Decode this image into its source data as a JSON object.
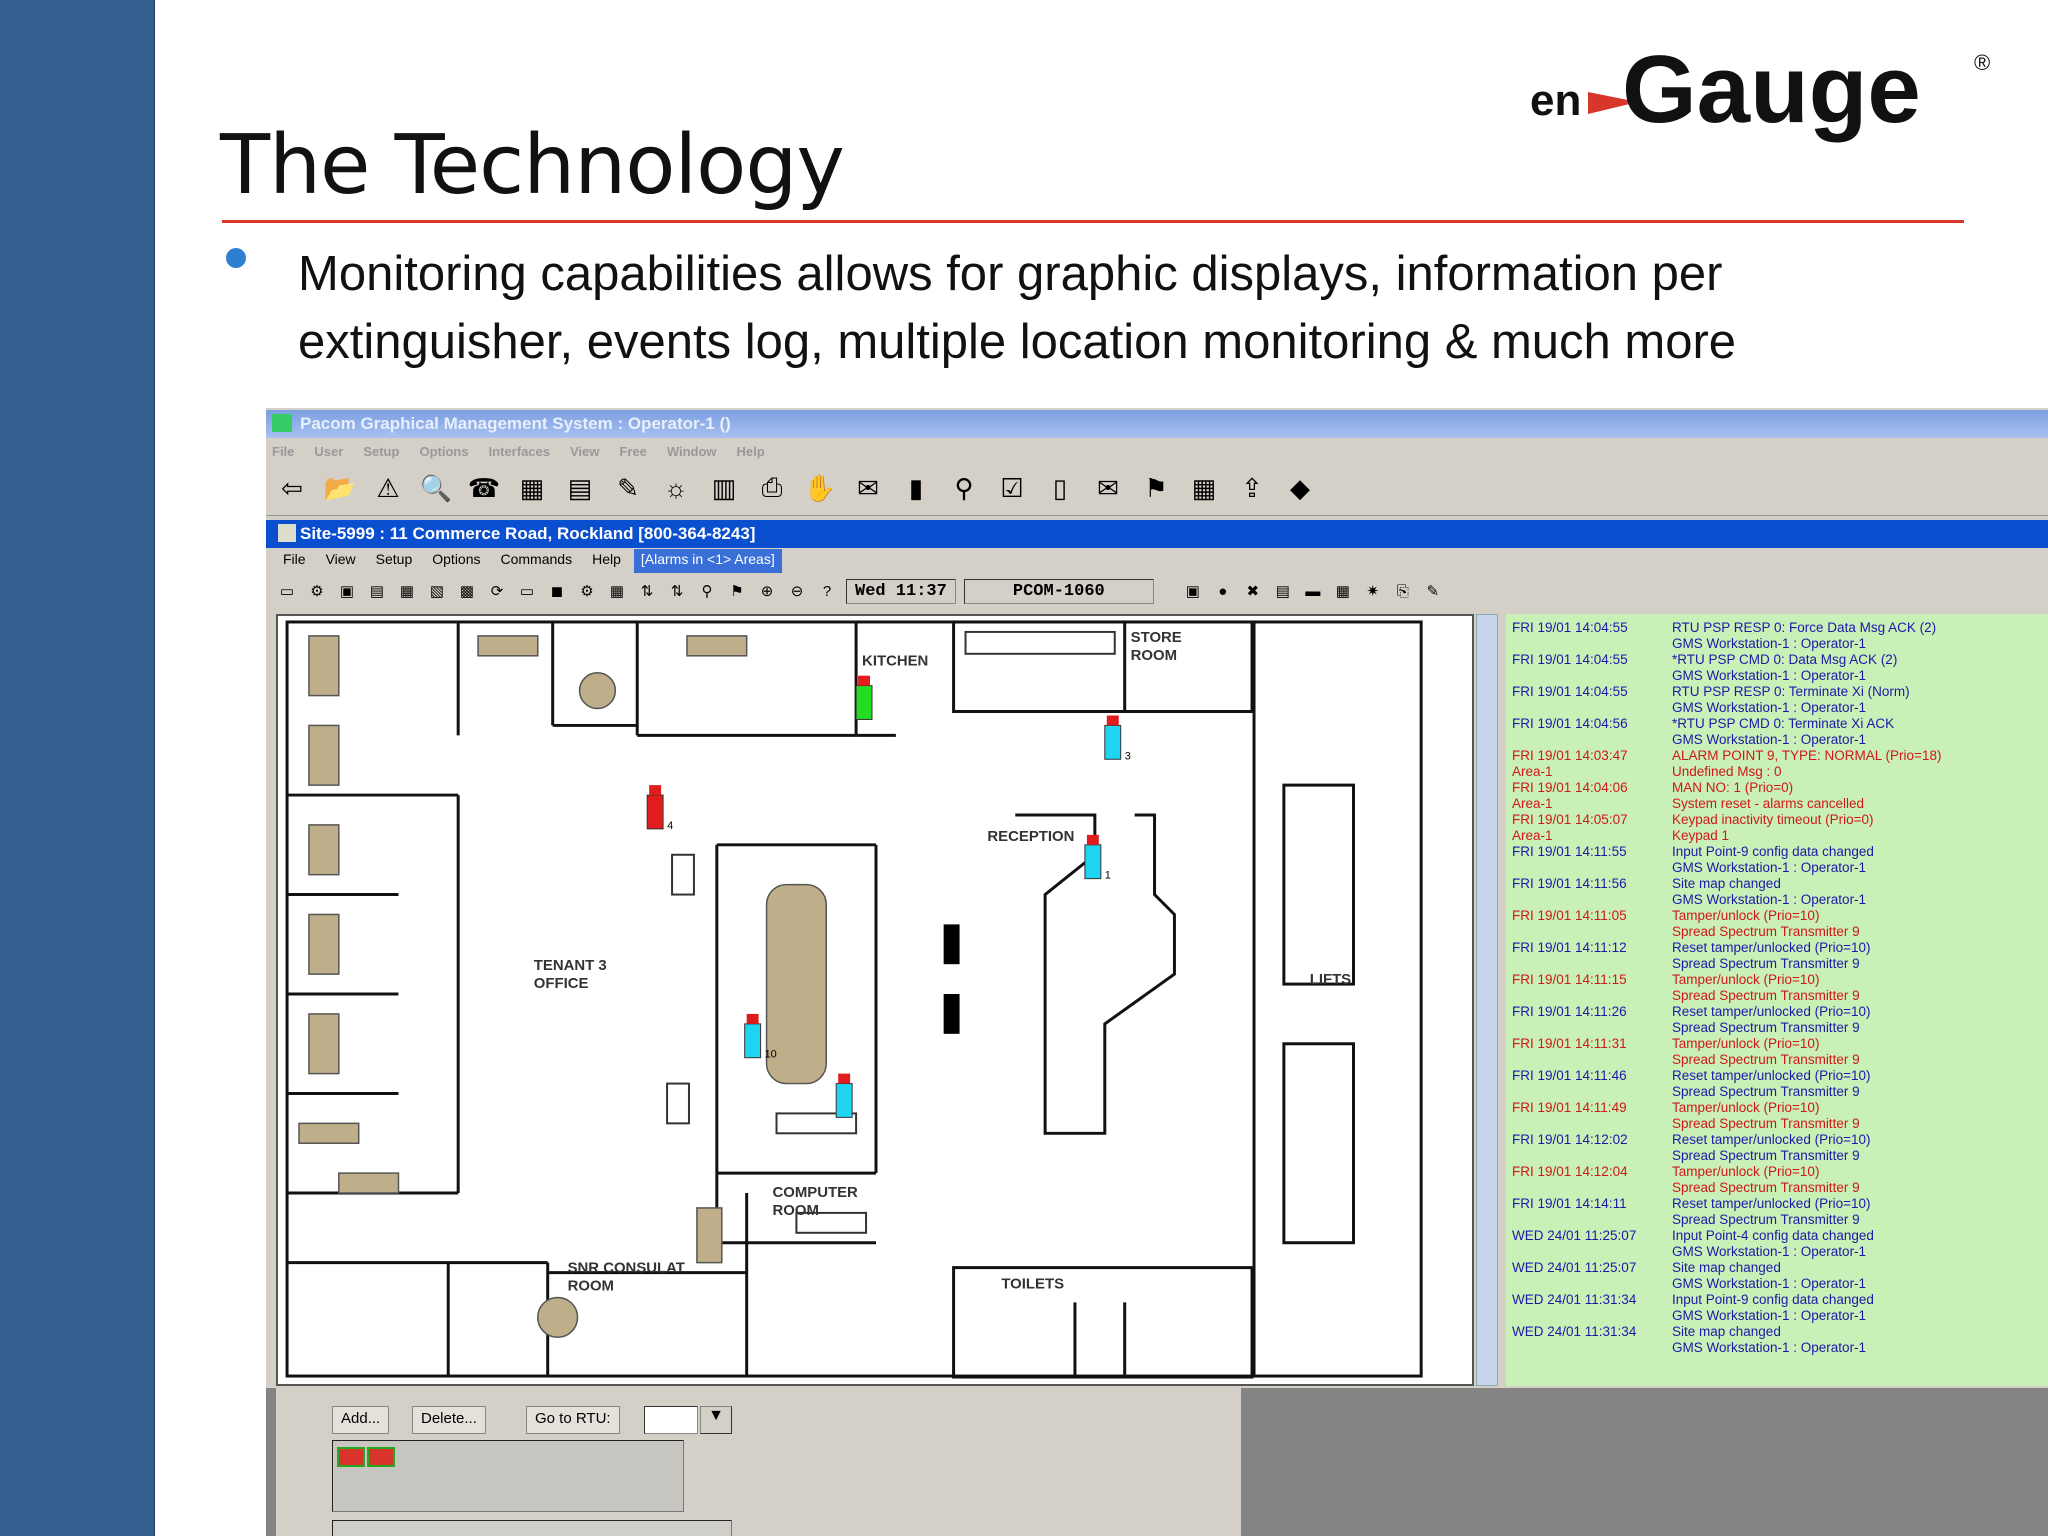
{
  "slide": {
    "title": "The Technology",
    "bullet": "Monitoring capabilities allows for graphic displays, information per extinguisher, events log, multiple location monitoring & much more",
    "logo_text_en": "en",
    "logo_text_main": "Gauge",
    "logo_reg": "®",
    "accent_color": "#d9362b",
    "sidebar_color": "#345f8f"
  },
  "app": {
    "outer_title": "Pacom Graphical Management System : Operator-1 ()",
    "outer_menu": [
      "File",
      "User",
      "Setup",
      "Options",
      "Interfaces",
      "View",
      "Free",
      "Window",
      "Help"
    ],
    "inner_title": "Site-5999 : 11 Commerce Road, Rockland [800-364-8243]",
    "inner_menu": [
      "File",
      "View",
      "Setup",
      "Options",
      "Commands",
      "Help"
    ],
    "alarms_label": "[Alarms in <1> Areas]",
    "clock": "Wed  11:37",
    "device": "PCOM-1060"
  },
  "map": {
    "rooms": {
      "kitchen": "KITCHEN",
      "store": "STORE",
      "store2": "ROOM",
      "reception": "RECEPTION",
      "tenant": "TENANT 3",
      "office": "OFFICE",
      "lifts": "LIFTS",
      "computer": "COMPUTER",
      "computer2": "ROOM",
      "snr": "SNR CONSULAT",
      "snr2": "ROOM",
      "toilets": "TOILETS"
    },
    "extinguishers": [
      {
        "label": "3",
        "color": "#1fd4f0"
      },
      {
        "label": "4",
        "color": "#e01c1c"
      },
      {
        "label": "1",
        "color": "#1fd4f0"
      },
      {
        "label": "10",
        "color": "#1fd4f0"
      },
      {
        "label": "",
        "color": "#22dd22"
      },
      {
        "label": "",
        "color": "#1fd4f0"
      }
    ]
  },
  "log": [
    {
      "time": "FRI 19/01 14:04:55",
      "msg": "RTU PSP RESP 0: Force Data Msg ACK (2)",
      "red": false
    },
    {
      "time": "",
      "msg": "GMS Workstation-1 : Operator-1",
      "red": false
    },
    {
      "time": "FRI 19/01 14:04:55",
      "msg": "*RTU PSP CMD 0: Data Msg ACK (2)",
      "red": false
    },
    {
      "time": "",
      "msg": "GMS Workstation-1 : Operator-1",
      "red": false
    },
    {
      "time": "FRI 19/01 14:04:55",
      "msg": "RTU PSP RESP 0: Terminate Xi (Norm)",
      "red": false
    },
    {
      "time": "",
      "msg": "GMS Workstation-1 : Operator-1",
      "red": false
    },
    {
      "time": "FRI 19/01 14:04:56",
      "msg": "*RTU PSP CMD 0: Terminate Xi ACK",
      "red": false
    },
    {
      "time": "",
      "msg": "GMS Workstation-1 : Operator-1",
      "red": false
    },
    {
      "time": "FRI 19/01 14:03:47",
      "msg": "ALARM POINT 9, TYPE: NORMAL (Prio=18)",
      "red": true
    },
    {
      "time": "Area-1",
      "msg": "Undefined Msg : 0",
      "red": true
    },
    {
      "time": "FRI 19/01 14:04:06",
      "msg": "MAN NO: 1 (Prio=0)",
      "red": true
    },
    {
      "time": "Area-1",
      "msg": "System reset - alarms cancelled",
      "red": true
    },
    {
      "time": "FRI 19/01 14:05:07",
      "msg": "Keypad inactivity timeout (Prio=0)",
      "red": true
    },
    {
      "time": "Area-1",
      "msg": "Keypad 1",
      "red": true
    },
    {
      "time": "FRI 19/01 14:11:55",
      "msg": "Input Point-9 config data changed",
      "red": false
    },
    {
      "time": "",
      "msg": "GMS Workstation-1 : Operator-1",
      "red": false
    },
    {
      "time": "FRI 19/01 14:11:56",
      "msg": "Site map changed",
      "red": false
    },
    {
      "time": "",
      "msg": "GMS Workstation-1 : Operator-1",
      "red": false
    },
    {
      "time": "FRI 19/01 14:11:05",
      "msg": "Tamper/unlock (Prio=10)",
      "red": true
    },
    {
      "time": "",
      "msg": "Spread Spectrum Transmitter 9",
      "red": true
    },
    {
      "time": "FRI 19/01 14:11:12",
      "msg": "Reset tamper/unlocked (Prio=10)",
      "red": false
    },
    {
      "time": "",
      "msg": "Spread Spectrum Transmitter 9",
      "red": false
    },
    {
      "time": "FRI 19/01 14:11:15",
      "msg": "Tamper/unlock (Prio=10)",
      "red": true
    },
    {
      "time": "",
      "msg": "Spread Spectrum Transmitter 9",
      "red": true
    },
    {
      "time": "FRI 19/01 14:11:26",
      "msg": "Reset tamper/unlocked (Prio=10)",
      "red": false
    },
    {
      "time": "",
      "msg": "Spread Spectrum Transmitter 9",
      "red": false
    },
    {
      "time": "FRI 19/01 14:11:31",
      "msg": "Tamper/unlock (Prio=10)",
      "red": true
    },
    {
      "time": "",
      "msg": "Spread Spectrum Transmitter 9",
      "red": true
    },
    {
      "time": "FRI 19/01 14:11:46",
      "msg": "Reset tamper/unlocked (Prio=10)",
      "red": false
    },
    {
      "time": "",
      "msg": "Spread Spectrum Transmitter 9",
      "red": false
    },
    {
      "time": "FRI 19/01 14:11:49",
      "msg": "Tamper/unlock (Prio=10)",
      "red": true
    },
    {
      "time": "",
      "msg": "Spread Spectrum Transmitter 9",
      "red": true
    },
    {
      "time": "FRI 19/01 14:12:02",
      "msg": "Reset tamper/unlocked (Prio=10)",
      "red": false
    },
    {
      "time": "",
      "msg": "Spread Spectrum Transmitter 9",
      "red": false
    },
    {
      "time": "FRI 19/01 14:12:04",
      "msg": "Tamper/unlock (Prio=10)",
      "red": true
    },
    {
      "time": "",
      "msg": "Spread Spectrum Transmitter 9",
      "red": true
    },
    {
      "time": "FRI 19/01 14:14:11",
      "msg": "Reset tamper/unlocked (Prio=10)",
      "red": false
    },
    {
      "time": "",
      "msg": "Spread Spectrum Transmitter 9",
      "red": false
    },
    {
      "time": "WED 24/01 11:25:07",
      "msg": "Input Point-4 config data changed",
      "red": false
    },
    {
      "time": "",
      "msg": "GMS Workstation-1 : Operator-1",
      "red": false
    },
    {
      "time": "WED 24/01 11:25:07",
      "msg": "Site map changed",
      "red": false
    },
    {
      "time": "",
      "msg": "GMS Workstation-1 : Operator-1",
      "red": false
    },
    {
      "time": "WED 24/01 11:31:34",
      "msg": "Input Point-9 config data changed",
      "red": false
    },
    {
      "time": "",
      "msg": "GMS Workstation-1 : Operator-1",
      "red": false
    },
    {
      "time": "WED 24/01 11:31:34",
      "msg": "Site map changed",
      "red": false
    },
    {
      "time": "",
      "msg": "GMS Workstation-1 : Operator-1",
      "red": false
    }
  ],
  "bottom": {
    "add": "Add...",
    "delete": "Delete...",
    "goto": "Go to RTU:",
    "drop": "▼"
  }
}
